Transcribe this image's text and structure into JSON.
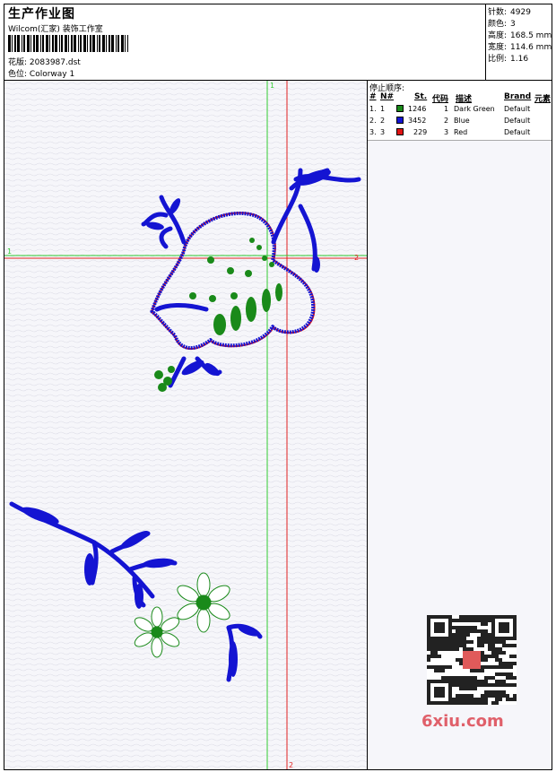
{
  "header": {
    "title": "生产作业图",
    "studio": "Wilcom(汇家) 装饰工作室",
    "design_label": "花版:",
    "design_file": "2083987.dst",
    "color_label": "色位:",
    "colorway": "Colorway 1"
  },
  "stats": [
    {
      "key": "针数:",
      "value": "4929"
    },
    {
      "key": "颜色:",
      "value": "3"
    },
    {
      "key": "高度:",
      "value": "168.5 mm"
    },
    {
      "key": "宽度:",
      "value": "114.6 mm"
    },
    {
      "key": "比例:",
      "value": "1.16"
    }
  ],
  "stop_sequence": {
    "title": "停止顺序:",
    "columns": [
      "#",
      "N#",
      "St.",
      "代码",
      "描述",
      "Brand",
      "元素"
    ],
    "rows": [
      {
        "n": "1.",
        "num": "1",
        "color": "#1a8a1a",
        "stitches": "1246",
        "code": "1",
        "desc": "Dark Green",
        "brand": "Default"
      },
      {
        "n": "2.",
        "num": "2",
        "color": "#1414d2",
        "stitches": "3452",
        "code": "2",
        "desc": "Blue",
        "brand": "Default"
      },
      {
        "n": "3.",
        "num": "3",
        "color": "#e01414",
        "stitches": "229",
        "code": "3",
        "desc": "Red",
        "brand": "Default"
      }
    ]
  },
  "guides": {
    "v_green_label": "1",
    "h_green_label": "1",
    "h_red_label": "2",
    "v_red_label": "2"
  },
  "watermark": "6xiu.com",
  "colors": {
    "green": "#1a8a1a",
    "blue": "#1414d2",
    "red": "#e01414",
    "guide_green": "#33cc33",
    "guide_red": "#e02020"
  }
}
